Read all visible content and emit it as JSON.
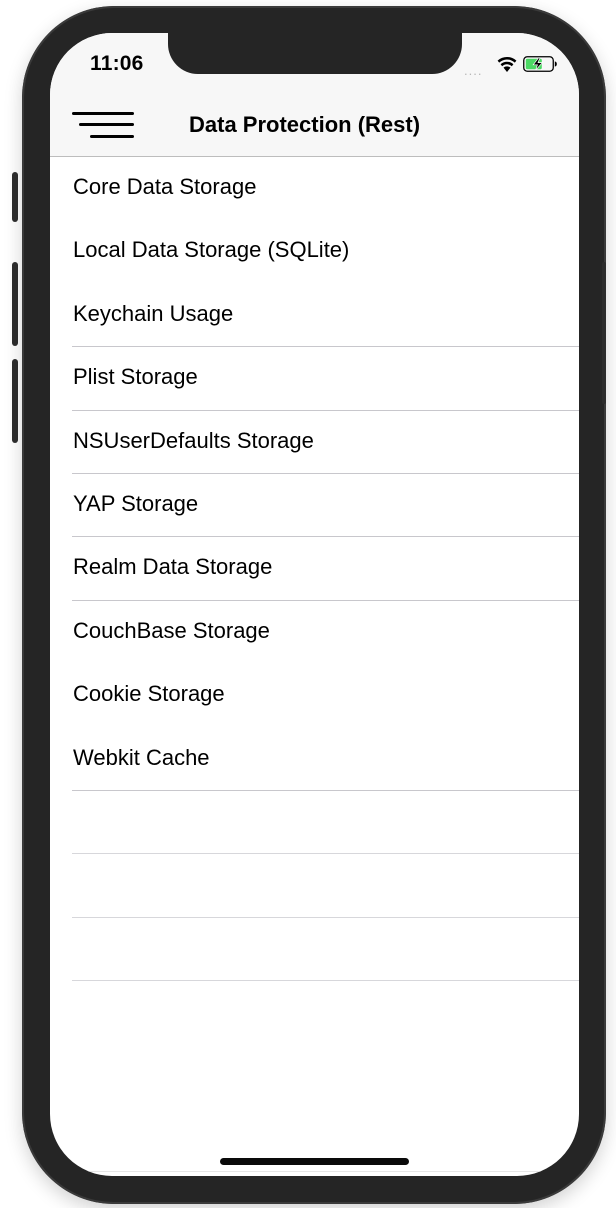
{
  "status_bar": {
    "time": "11:06",
    "signal_dots": "....",
    "wifi_icon": "wifi-icon",
    "battery_icon": "battery-charging-icon",
    "battery_color": "#4cd964"
  },
  "nav_bar": {
    "title": "Data Protection (Rest)",
    "menu_icon": "hamburger-menu-icon"
  },
  "list": {
    "items": [
      {
        "label": "Core Data Storage"
      },
      {
        "label": "Local Data Storage (SQLite)"
      },
      {
        "label": "Keychain Usage"
      },
      {
        "label": "Plist Storage"
      },
      {
        "label": "NSUserDefaults Storage"
      },
      {
        "label": "YAP Storage"
      },
      {
        "label": "Realm Data Storage"
      },
      {
        "label": "CouchBase Storage"
      },
      {
        "label": "Cookie Storage"
      },
      {
        "label": "Webkit Cache"
      }
    ]
  }
}
